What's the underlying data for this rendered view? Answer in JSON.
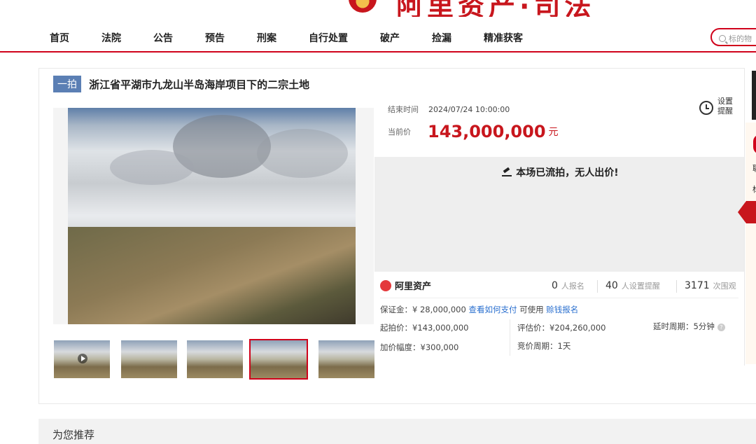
{
  "header": {
    "logo_text": "阿里资产·司法"
  },
  "nav": {
    "items": [
      {
        "label": "首页"
      },
      {
        "label": "法院"
      },
      {
        "label": "公告"
      },
      {
        "label": "预告"
      },
      {
        "label": "刑案"
      },
      {
        "label": "自行处置"
      },
      {
        "label": "破产"
      },
      {
        "label": "捡漏"
      },
      {
        "label": "精准获客"
      }
    ],
    "search_placeholder": "标的物"
  },
  "auction": {
    "round_badge": "一拍",
    "title": "浙江省平湖市九龙山半岛海岸项目下的二宗土地",
    "end_time_label": "结束时间",
    "end_time": "2024/07/24 10:00:00",
    "remind_label": "设置提醒",
    "current_price_label": "当前价",
    "current_price": "143,000,000",
    "currency_unit": "元",
    "status": "本场已流拍，无人出价!",
    "platform": "阿里资产",
    "stats": {
      "signup_count": "0",
      "signup_label": "人报名",
      "remind_count": "40",
      "remind_label": "人设置提醒",
      "view_count": "3171",
      "view_label": "次围观"
    },
    "terms": {
      "deposit": "保证金：¥ 28,000,000",
      "how_to_pay": "查看如何支付",
      "can_use": "可使用",
      "earn_signup": "赊钱报名",
      "start_price": "起拍价：¥143,000,000",
      "appraisal": "评估价：¥204,260,000",
      "extension": "延时周期：5分钟",
      "increment": "加价幅度：¥300,000",
      "bid_period": "竞价周期：1天"
    },
    "thumbnails_count": 5,
    "selected_thumbnail": 4
  },
  "side": {
    "text1": "联",
    "text2": "标"
  },
  "recommend": {
    "title": "为您推荐"
  }
}
